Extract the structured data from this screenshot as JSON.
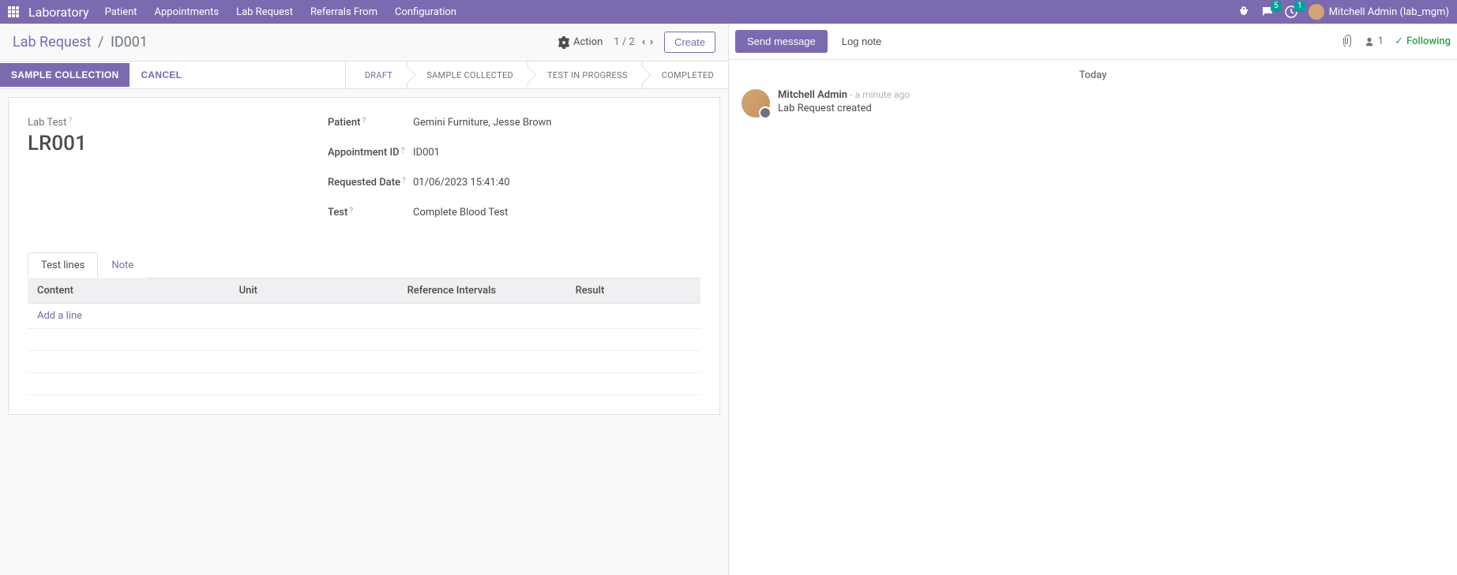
{
  "topnav": {
    "brand": "Laboratory",
    "menu": [
      "Patient",
      "Appointments",
      "Lab Request",
      "Referrals From",
      "Configuration"
    ],
    "chat_badge": "5",
    "clock_badge": "1",
    "user": "Mitchell Admin (lab_mgm)"
  },
  "breadcrumb": {
    "root": "Lab Request",
    "current": "ID001"
  },
  "cp": {
    "action_label": "Action",
    "pager": "1 / 2",
    "create": "Create"
  },
  "statusbar": {
    "primary": "SAMPLE COLLECTION",
    "cancel": "CANCEL",
    "stages": [
      "DRAFT",
      "SAMPLE COLLECTED",
      "TEST IN PROGRESS",
      "COMPLETED"
    ],
    "active_stage": 0
  },
  "form": {
    "lab_test_label": "Lab Test",
    "lab_test_value": "LR001",
    "fields": [
      {
        "label": "Patient",
        "value": "Gemini Furniture, Jesse Brown"
      },
      {
        "label": "Appointment ID",
        "value": "ID001"
      },
      {
        "label": "Requested Date",
        "value": "01/06/2023 15:41:40"
      },
      {
        "label": "Test",
        "value": "Complete Blood Test"
      }
    ]
  },
  "notebook": {
    "tabs": [
      "Test lines",
      "Note"
    ],
    "columns": [
      "Content",
      "Unit",
      "Reference Intervals",
      "Result"
    ],
    "add_line": "Add a line"
  },
  "chatter": {
    "send": "Send message",
    "log": "Log note",
    "followers": "1",
    "following": "Following",
    "date": "Today",
    "msg_author": "Mitchell Admin",
    "msg_time": "- a minute ago",
    "msg_body": "Lab Request created"
  }
}
